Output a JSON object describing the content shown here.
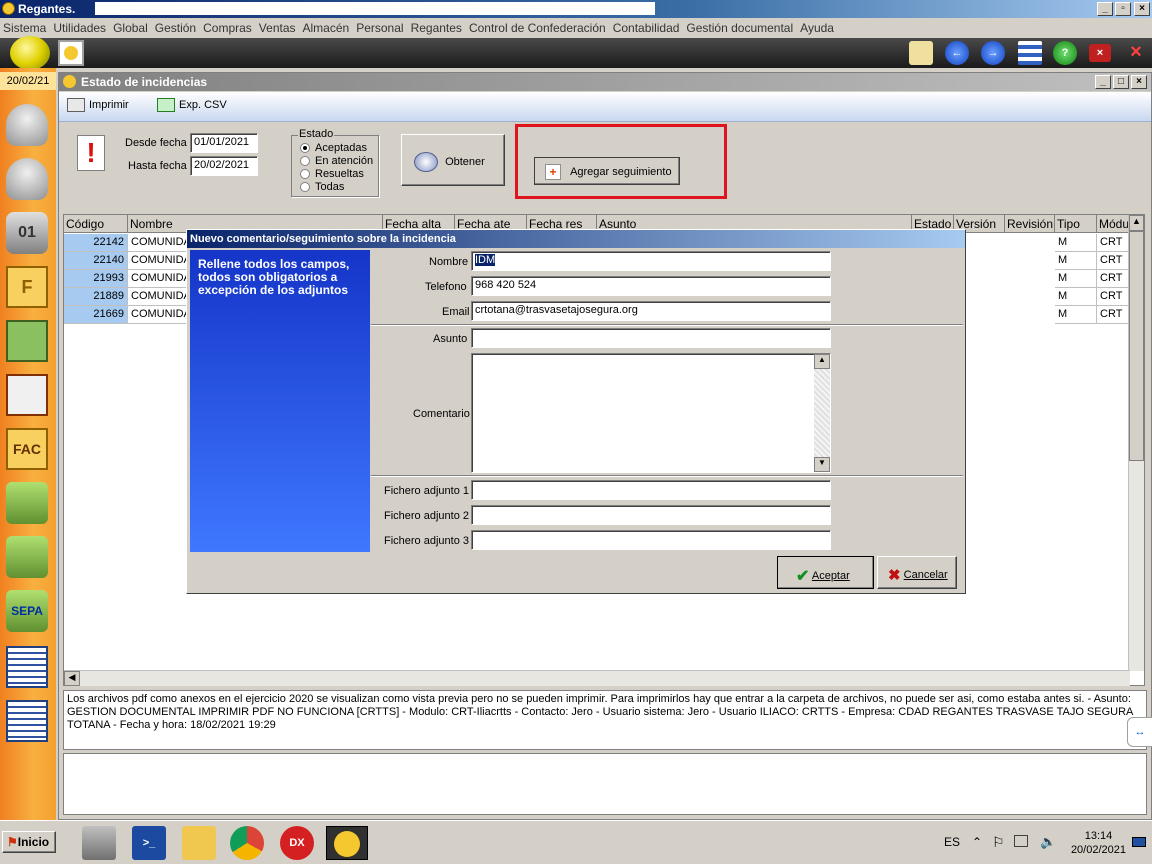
{
  "app": {
    "title": "Regantes.",
    "date_badge": "20/02/21"
  },
  "menu": [
    "Sistema",
    "Utilidades",
    "Global",
    "Gestión",
    "Compras",
    "Ventas",
    "Almacén",
    "Personal",
    "Regantes",
    "Control de Confederación",
    "Contabilidad",
    "Gestión documental",
    "Ayuda"
  ],
  "child_window": {
    "title": "Estado de incidencias",
    "tools": {
      "print": "Imprimir",
      "export": "Exp. CSV"
    },
    "filters": {
      "from_label": "Desde fecha",
      "from_value": "01/01/2021",
      "to_label": "Hasta fecha",
      "to_value": "20/02/2021",
      "state_label": "Estado",
      "states": [
        "Aceptadas",
        "En atención",
        "Resueltas",
        "Todas"
      ],
      "selected_state": "Aceptadas"
    },
    "obtain_button": "Obtener",
    "add_followup_button": "Agregar seguimiento",
    "grid": {
      "columns": [
        "Código",
        "Nombre",
        "Fecha alta",
        "Fecha ate",
        "Fecha res",
        "Asunto",
        "Estado",
        "Versión",
        "Revisión",
        "Tipo",
        "Módul"
      ],
      "rows": [
        {
          "codigo": "22142",
          "nombre": "COMUNIDA",
          "tipo": "M",
          "modulo": "CRT"
        },
        {
          "codigo": "22140",
          "nombre": "COMUNIDA",
          "tipo": "M",
          "modulo": "CRT"
        },
        {
          "codigo": "21993",
          "nombre": "COMUNIDA",
          "tipo": "M",
          "modulo": "CRT"
        },
        {
          "codigo": "21889",
          "nombre": "COMUNIDA",
          "tipo": "M",
          "modulo": "CRT"
        },
        {
          "codigo": "21669",
          "nombre": "COMUNIDA",
          "tipo": "M",
          "modulo": "CRT"
        }
      ]
    },
    "memo_text": "Los archivos pdf como anexos en el ejercicio 2020 se visualizan como vista previa pero no se pueden imprimir.  Para imprimirlos hay que entrar a la carpeta de archivos, no puede ser asi, como estaba antes si.   - Asunto: GESTION DOCUMENTAL IMPRIMIR PDF NO FUNCIONA [CRTTS] - Modulo: CRT-Iliacrtts - Contacto: Jero - Usuario sistema: Jero - Usuario ILIACO: CRTTS - Empresa: CDAD  REGANTES TRASVASE TAJO SEGURA TOTANA - Fecha y hora: 18/02/2021 19:29"
  },
  "dialog": {
    "title": "Nuevo comentario/seguimiento sobre la incidencia",
    "side_text": "Rellene todos los campos, todos son obligatorios a excepción de los adjuntos",
    "nombre_label": "Nombre",
    "nombre_value": "IDM",
    "telefono_label": "Telefono",
    "telefono_value": "968 420 524",
    "email_label": "Email",
    "email_value": "crtotana@trasvasetajosegura.org",
    "asunto_label": "Asunto",
    "asunto_value": "",
    "comentario_label": "Comentario",
    "comentario_value": "",
    "adj1_label": "Fichero adjunto 1",
    "adj2_label": "Fichero adjunto 2",
    "adj3_label": "Fichero adjunto 3",
    "ok_button": "Aceptar",
    "cancel_button": "Cancelar"
  },
  "taskbar": {
    "start": "Inicio",
    "lang": "ES",
    "time": "13:14",
    "date": "20/02/2021"
  },
  "colors": {
    "highlight_box": "#e0141e",
    "selection": "#a6caf0",
    "dialog_side": "#2a56e8"
  }
}
